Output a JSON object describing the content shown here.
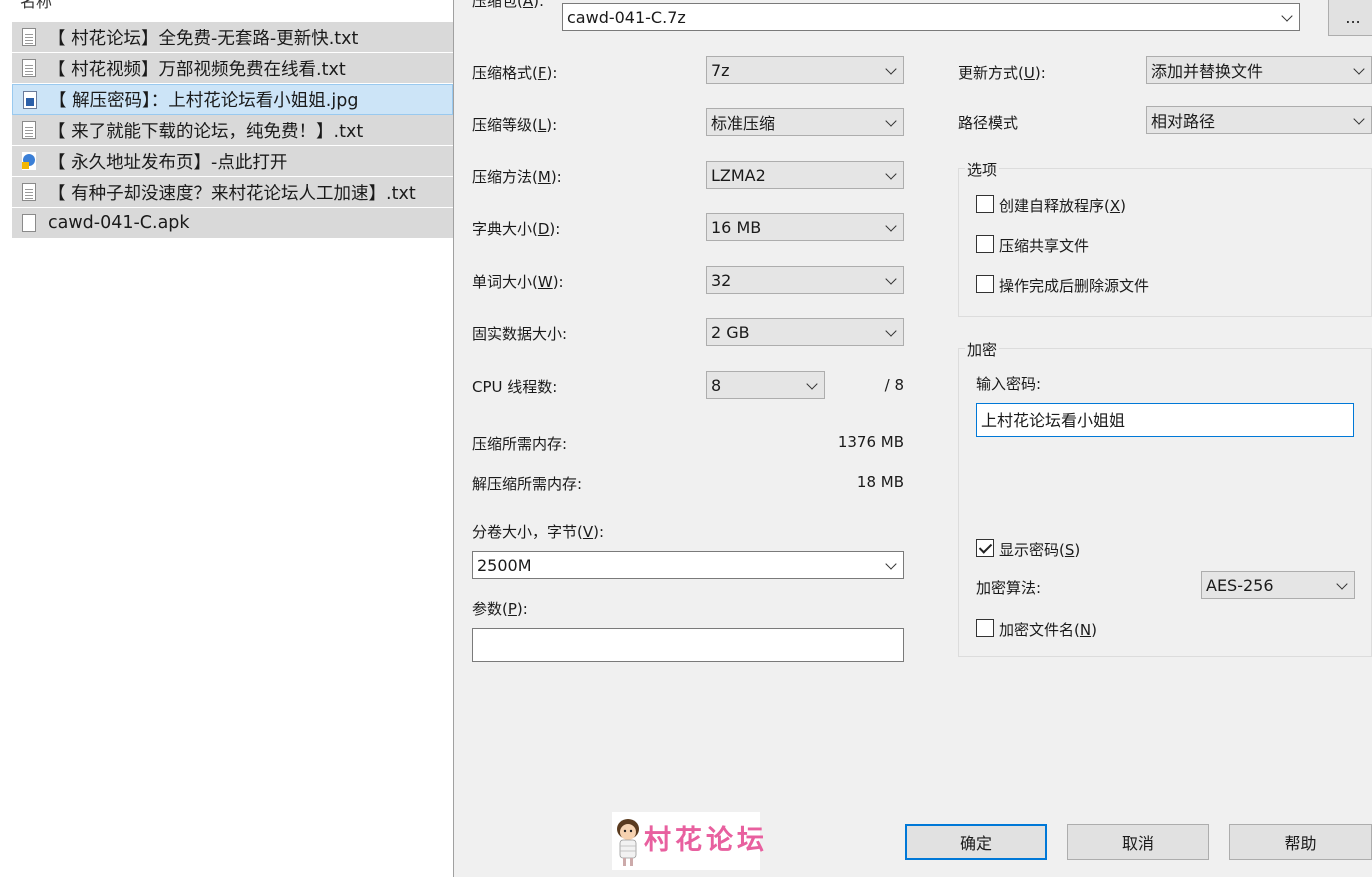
{
  "file_list": {
    "header": "名称",
    "items": [
      {
        "name": "【 村花论坛】全免费-无套路-更新快.txt",
        "icon": "text-file-icon",
        "selected": false
      },
      {
        "name": "【 村花视频】万部视频免费在线看.txt",
        "icon": "text-file-icon",
        "selected": false
      },
      {
        "name": "【 解压密码】：上村花论坛看小姐姐.jpg",
        "icon": "image-file-icon",
        "selected": true
      },
      {
        "name": "【 来了就能下载的论坛，纯免费！】.txt",
        "icon": "text-file-icon",
        "selected": false
      },
      {
        "name": "【 永久地址发布页】-点此打开",
        "icon": "url-shortcut-icon",
        "selected": false
      },
      {
        "name": "【 有种子却没速度？来村花论坛人工加速】.txt",
        "icon": "text-file-icon",
        "selected": false
      },
      {
        "name": "cawd-041-C.apk",
        "icon": "blank-file-icon",
        "selected": false
      }
    ]
  },
  "archive": {
    "label_prefix": "压缩包(",
    "label_key": "A",
    "label_suffix": "):",
    "value": "cawd-041-C.7z",
    "browse_label": "..."
  },
  "format": {
    "label_prefix": "压缩格式(",
    "key": "F",
    "label_suffix": "):",
    "value": "7z"
  },
  "level": {
    "label_prefix": "压缩等级(",
    "key": "L",
    "label_suffix": "):",
    "value": "标准压缩"
  },
  "method": {
    "label_prefix": "压缩方法(",
    "key": "M",
    "label_suffix": "):",
    "value": "LZMA2"
  },
  "dict": {
    "label_prefix": "字典大小(",
    "key": "D",
    "label_suffix": "):",
    "value": "16 MB"
  },
  "word": {
    "label_prefix": "单词大小(",
    "key": "W",
    "label_suffix": "):",
    "value": "32"
  },
  "solid": {
    "label": "固实数据大小:",
    "value": "2 GB"
  },
  "cpu": {
    "label": "CPU 线程数:",
    "value": "8",
    "total": "/ 8"
  },
  "memory": {
    "compress_label": "压缩所需内存:",
    "compress_value": "1376 MB",
    "decompress_label": "解压缩所需内存:",
    "decompress_value": "18 MB"
  },
  "volume": {
    "label_prefix": "分卷大小，字节(",
    "key": "V",
    "label_suffix": "):",
    "value": "2500M"
  },
  "params": {
    "label_prefix": "参数(",
    "key": "P",
    "label_suffix": "):",
    "value": ""
  },
  "update": {
    "label_prefix": "更新方式(",
    "key": "U",
    "label_suffix": "):",
    "value": "添加并替换文件"
  },
  "path_mode": {
    "label": "路径模式",
    "value": "相对路径"
  },
  "options": {
    "title": "选项",
    "sfx": {
      "label_prefix": "创建自释放程序(",
      "key": "X",
      "label_suffix": ")",
      "checked": false
    },
    "shared": {
      "label": "压缩共享文件",
      "checked": false
    },
    "delete": {
      "label": "操作完成后删除源文件",
      "checked": false
    }
  },
  "encryption": {
    "title": "加密",
    "password_label": "输入密码:",
    "password_value": "上村花论坛看小姐姐",
    "show_password": {
      "label_prefix": "显示密码(",
      "key": "S",
      "label_suffix": ")",
      "checked": true
    },
    "method_label": "加密算法:",
    "method_value": "AES-256",
    "encrypt_names": {
      "label_prefix": "加密文件名(",
      "key": "N",
      "label_suffix": ")",
      "checked": false
    }
  },
  "buttons": {
    "ok": "确定",
    "cancel": "取消",
    "help": "帮助"
  },
  "watermark": {
    "text": "村花论坛",
    "color": "#e8609f"
  },
  "colors": {
    "selected_row": "#cce4f7",
    "row_bg": "#d9d9d9",
    "dialog_bg": "#f0f0f0",
    "accent": "#0078d7"
  }
}
